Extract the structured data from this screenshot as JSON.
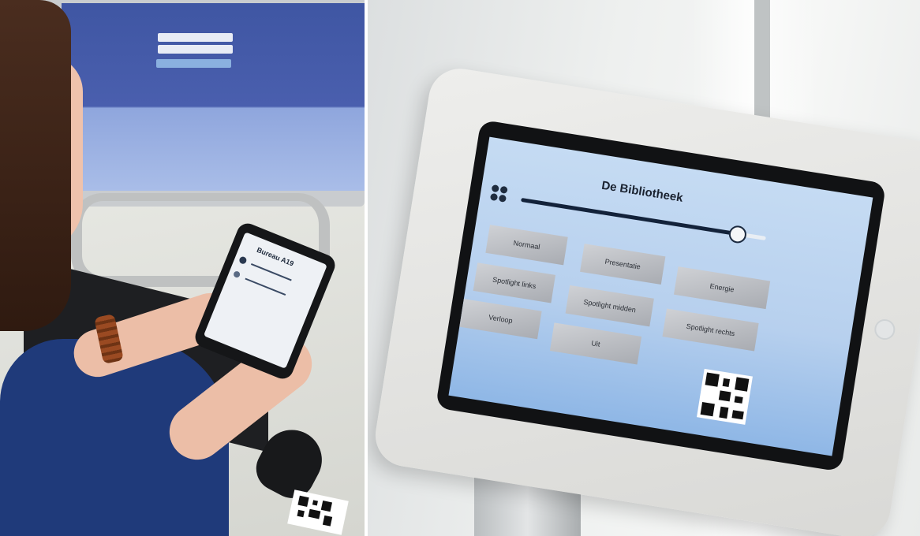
{
  "left_photo": {
    "monitor_buttons": {
      "submit": ""
    },
    "phone": {
      "title": "Bureau A19"
    }
  },
  "right_photo": {
    "tablet": {
      "title": "De Bibliotheek",
      "slider_level_fraction": 0.88,
      "scenes": [
        {
          "label": "Normaal",
          "state": "selected"
        },
        {
          "label": "Presentatie",
          "state": "default"
        },
        {
          "label": "Energie",
          "state": "light"
        },
        {
          "label": "Spotlight links",
          "state": "default"
        },
        {
          "label": "Spotlight midden",
          "state": "default"
        },
        {
          "label": "Spotlight rechts",
          "state": "default"
        },
        {
          "label": "Verloop",
          "state": "default"
        },
        {
          "label": "Uit",
          "state": "default"
        }
      ]
    }
  },
  "colors": {
    "monitor_screen": "#3f56a3",
    "tablet_screen": "#c5dbf3",
    "slider_track": "#13223a",
    "shirt": "#1f3a7a"
  }
}
